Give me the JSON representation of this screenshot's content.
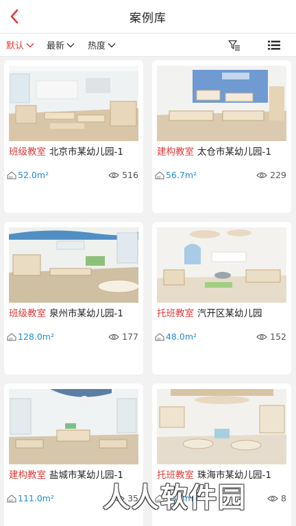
{
  "header": {
    "title": "案例库"
  },
  "filters": {
    "items": [
      {
        "label": "默认",
        "active": true
      },
      {
        "label": "最新",
        "active": false
      },
      {
        "label": "热度",
        "active": false
      }
    ]
  },
  "cases": [
    {
      "tag": "班级教室",
      "name": "北京市某幼儿园-1",
      "area": "52.0m²",
      "views": "516"
    },
    {
      "tag": "建构教室",
      "name": "太仓市某幼儿园-1",
      "area": "56.7m²",
      "views": "229"
    },
    {
      "tag": "班级教室",
      "name": "泉州市某幼儿园-1",
      "area": "128.0m²",
      "views": "177"
    },
    {
      "tag": "托班教室",
      "name": "汽开区某幼儿园",
      "area": "48.0m²",
      "views": "152"
    },
    {
      "tag": "建构教室",
      "name": "盐城市某幼儿园-1",
      "area": "111.0m²",
      "views": "35"
    },
    {
      "tag": "托班教室",
      "name": "珠海市某幼儿园-1",
      "area": "95.3m²",
      "views": "8"
    }
  ],
  "watermark": {
    "text": "人人软件园"
  },
  "colors": {
    "accent": "#e03838",
    "area_blue": "#1f8ad6"
  }
}
